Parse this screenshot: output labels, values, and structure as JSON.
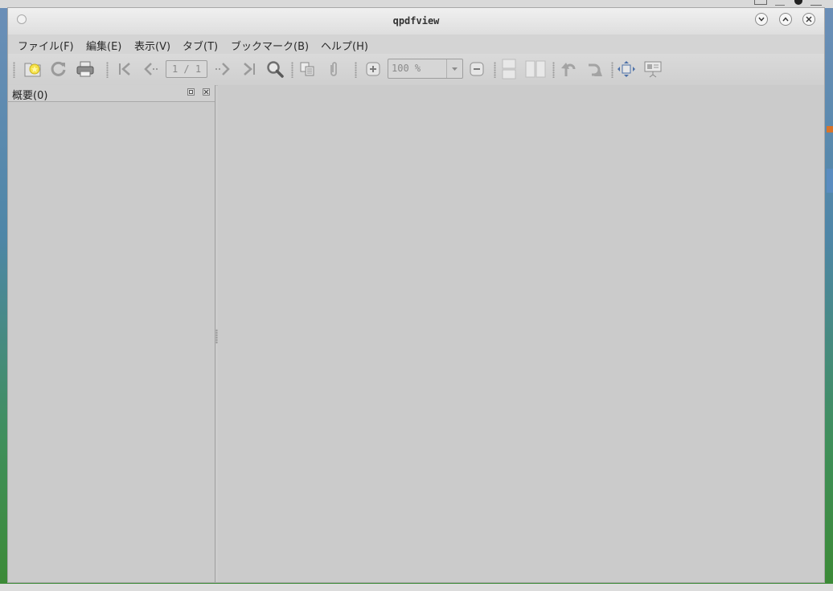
{
  "window": {
    "title": "qpdfview"
  },
  "menubar": {
    "items": [
      {
        "label": "ファイル(F)"
      },
      {
        "label": "編集(E)"
      },
      {
        "label": "表示(V)"
      },
      {
        "label": "タブ(T)"
      },
      {
        "label": "ブックマーク(B)"
      },
      {
        "label": "ヘルプ(H)"
      }
    ]
  },
  "toolbar": {
    "page_indicator": "1 / 1",
    "zoom_value": "100 %",
    "icons": [
      "open-icon",
      "refresh-icon",
      "print-icon",
      "first-page-icon",
      "previous-page-icon",
      "next-page-icon",
      "last-page-icon",
      "search-icon",
      "copy-icon",
      "attachment-icon",
      "zoom-in-icon",
      "zoom-out-icon",
      "continuous-mode-icon",
      "two-pages-mode-icon",
      "rotate-left-icon",
      "rotate-right-icon",
      "fit-to-page-icon",
      "presentation-icon"
    ]
  },
  "sidepanel": {
    "title": "概要(0)"
  },
  "colors": {
    "window_bg": "#cdcdcd",
    "open_star": "#f6e24a"
  }
}
